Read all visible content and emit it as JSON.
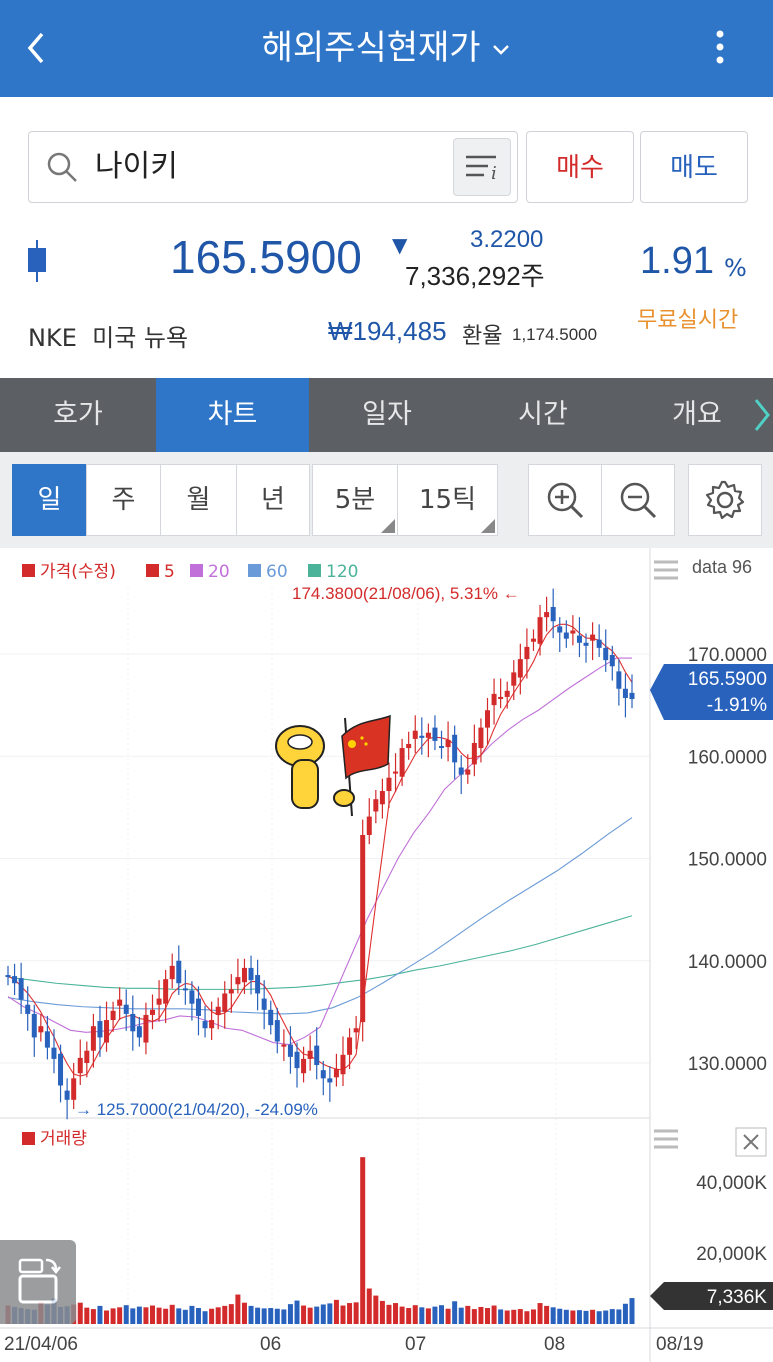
{
  "header": {
    "title": "해외주식현재가",
    "back_icon": "chevron-left-icon",
    "menu_icon": "more-vertical-icon"
  },
  "search": {
    "value": "나이키",
    "icon": "search-icon",
    "filter_icon": "list-info-icon"
  },
  "actions": {
    "buy_label": "매수",
    "sell_label": "매도"
  },
  "quote": {
    "price": "165.5900",
    "direction": "▼",
    "change": "3.2200",
    "volume": "7,336,292주",
    "change_pct": "1.91",
    "pct_sign": "%",
    "realtime_label": "무료실시간",
    "ticker": "NKE  미국 뉴욕",
    "krw_price": "₩194,485",
    "fx_label": "환율",
    "fx_rate": "1,174.5000"
  },
  "tabs": [
    "호가",
    "차트",
    "일자",
    "시간",
    "개요"
  ],
  "active_tab": 1,
  "period": {
    "items": [
      "일",
      "주",
      "월",
      "년",
      "5분",
      "15틱"
    ],
    "active": 0
  },
  "tools": {
    "zoom_in_icon": "zoom-in-icon",
    "zoom_out_icon": "zoom-out-icon",
    "settings_icon": "gear-icon"
  },
  "colors": {
    "accent": "#2f76c9",
    "up": "#d32b2b",
    "down": "#2962bd",
    "ma5": "#e03030",
    "ma20": "#c070d8",
    "ma60": "#6a9bd8",
    "ma120": "#4bb39a"
  },
  "chart_data": {
    "type": "candlestick",
    "legend": [
      {
        "label": "가격(수정)",
        "color": "#d32b2b"
      },
      {
        "label": "5",
        "color": "#d32b2b"
      },
      {
        "label": "20",
        "color": "#c070d8"
      },
      {
        "label": "60",
        "color": "#6a9bd8"
      },
      {
        "label": "120",
        "color": "#4bb39a"
      }
    ],
    "data_label": "data 96",
    "y_ticks": [
      "170.0000",
      "160.0000",
      "150.0000",
      "140.0000",
      "130.0000"
    ],
    "y_tick_values": [
      170,
      160,
      150,
      140,
      130
    ],
    "current_price": "165.5900",
    "current_change": "-1.91%",
    "max_annotation": "174.3800(21/08/06), 5.31% ←",
    "min_annotation": "→ 125.7000(21/04/20), -24.09%",
    "volume_label": "거래량",
    "volume_ticks": [
      "40,000K",
      "20,000K"
    ],
    "volume_tick_values": [
      40000,
      20000
    ],
    "current_volume": "7,336K",
    "x_labels": [
      "21/04/06",
      "06",
      "07",
      "08",
      "08/19"
    ],
    "close_series": [
      138.5,
      137.8,
      136.2,
      134.8,
      132.5,
      133.6,
      131.5,
      130.4,
      127.8,
      126.4,
      128.5,
      130.5,
      131.2,
      133.6,
      132.5,
      134.2,
      135.1,
      136.2,
      134.8,
      133.1,
      132.5,
      134.7,
      135.2,
      136.3,
      138.2,
      139.5,
      137.8,
      137.1,
      135.8,
      134.6,
      133.4,
      134.2,
      135.5,
      136.8,
      137.2,
      138.4,
      139.3,
      138.1,
      136.8,
      135.2,
      133.7,
      132.1,
      131.8,
      130.6,
      129.5,
      130.4,
      131.2,
      129.8,
      128.5,
      128.1,
      129.4,
      130.8,
      132.5,
      133.4,
      152.3,
      154.1,
      155.8,
      156.6,
      157.9,
      158.5,
      160.8,
      161.2,
      162.5,
      161.8,
      162.3,
      161.5,
      160.9,
      161.6,
      159.4,
      158.2,
      158.7,
      161.3,
      162.8,
      164.5,
      166.1,
      165.8,
      166.4,
      168.2,
      169.5,
      170.7,
      171.5,
      173.6,
      174.1,
      173.2,
      172.1,
      171.5,
      172.3,
      171.1,
      170.8,
      171.9,
      170.6,
      169.4,
      168.8,
      166.6,
      165.7,
      165.6
    ],
    "ma20": [
      136.5,
      135.5,
      134.8,
      134.0,
      133.2,
      133.0,
      133.1,
      133.3,
      133.6,
      134.0,
      134.2,
      134.6,
      134.5,
      134.0,
      133.4,
      133.2,
      132.6,
      132.0,
      131.8,
      132.5,
      133.5,
      137.0,
      140.5,
      144.0,
      147.0,
      150.0,
      152.5,
      154.5,
      156.8,
      158.2,
      159.6,
      161.2,
      162.5,
      163.6,
      164.5,
      165.6,
      166.7,
      167.7,
      168.7,
      169.6,
      169.6
    ],
    "ma60": [
      136.4,
      136.0,
      135.7,
      135.5,
      135.4,
      135.3,
      135.3,
      135.3,
      135.2,
      135.0,
      134.9,
      134.8,
      134.9,
      135.4,
      136.4,
      137.8,
      139.3,
      140.8,
      142.5,
      144.2,
      145.8,
      147.3,
      148.8,
      150.5,
      152.3,
      154.0
    ],
    "ma120": [
      138.4,
      138.1,
      137.8,
      137.6,
      137.4,
      137.3,
      137.3,
      137.2,
      137.2,
      137.2,
      137.2,
      137.3,
      137.4,
      137.6,
      137.9,
      138.2,
      138.6,
      139.1,
      139.5,
      140.0,
      140.5,
      141.0,
      141.6,
      142.3,
      143.0,
      143.7,
      144.4
    ],
    "volume_values": [
      5200,
      4800,
      4500,
      4200,
      4000,
      6100,
      5500,
      7200,
      4800,
      5000,
      5500,
      6000,
      4600,
      4200,
      5100,
      3800,
      4400,
      4700,
      5300,
      4400,
      4900,
      4700,
      5200,
      4600,
      4300,
      5400,
      4400,
      4000,
      5100,
      4500,
      3600,
      4300,
      4700,
      5100,
      5600,
      8300,
      6000,
      5100,
      4600,
      4400,
      4500,
      4300,
      4100,
      5600,
      6600,
      5200,
      4600,
      4900,
      5500,
      5800,
      6800,
      5200,
      5900,
      6100,
      47000,
      10000,
      8000,
      6500,
      5400,
      5900,
      4900,
      4500,
      5300,
      4700,
      4400,
      4900,
      5300,
      4300,
      6400,
      4600,
      5100,
      4200,
      4800,
      4500,
      5200,
      4100,
      3800,
      4000,
      4200,
      3600,
      4100,
      5900,
      5100,
      4700,
      4300,
      4000,
      3800,
      3900,
      3700,
      4000,
      3600,
      3800,
      4200,
      4100,
      5700,
      7300
    ]
  }
}
